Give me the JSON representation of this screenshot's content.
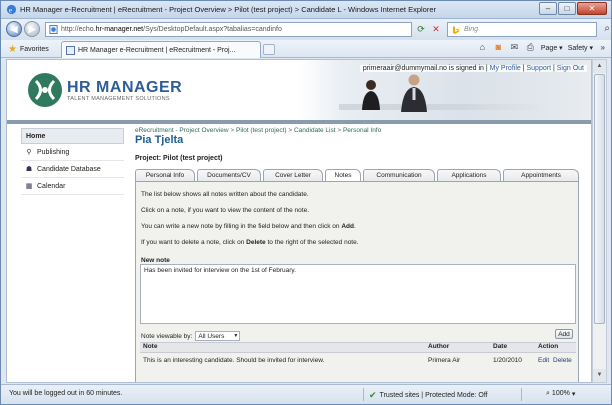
{
  "browser": {
    "title": "HR Manager e-Recruitment | eRecruitment - Project Overview > Pilot (test project) > Candidate L - Windows Internet Explorer",
    "url_prefix": "http://echo.",
    "url_domain": "hr-manager.net",
    "url_path": "/Sys/DesktopDefault.aspx?tabalias=candinfo",
    "search_placeholder": "Bing",
    "favorites_label": "Favorites",
    "tab_title": "HR Manager e-Recruitment | eRecruitment - Proj...",
    "page_menu": "Page ▾",
    "safety_menu": "Safety ▾",
    "status_left": "You will be logged out in 60 minutes.",
    "status_zone": "Trusted sites | Protected Mode: Off",
    "zoom": "100%"
  },
  "header": {
    "logo_name": "HR MANAGER",
    "logo_tagline": "TALENT MANAGEMENT SOLUTIONS",
    "user_email": "primeraair@dummymail.no",
    "signed_in_text": " is signed in | ",
    "my_profile": "My Profile",
    "support": "Support",
    "sign_out": "Sign Out",
    "sep": " | "
  },
  "sidebar": {
    "items": [
      {
        "label": "Home",
        "icon": "home"
      },
      {
        "label": "Publishing",
        "icon": "publishing-icon"
      },
      {
        "label": "Candidate Database",
        "icon": "people-icon"
      },
      {
        "label": "Calendar",
        "icon": "calendar-icon"
      }
    ]
  },
  "main": {
    "breadcrumb": [
      "eRecruitment - Project Overview",
      "Pilot (test project)",
      "Candidate List",
      "Personal Info"
    ],
    "breadcrumb_sep": " > ",
    "candidate_name": "Pia Tjelta",
    "project_label": "Project: Pilot (test project)",
    "tabs": [
      "Personal Info",
      "Documents/CV",
      "Cover Letter",
      "Notes",
      "Communication",
      "Applications",
      "Appointments"
    ],
    "active_tab": "Notes",
    "instructions": {
      "line1": "The list below shows all notes written about the candidate.",
      "line2": "Click on a note, if you want to view the content of the note.",
      "line3_pre": "You can write a new note by filling in the field below and then click on ",
      "line3_bold": "Add",
      "line3_post": ".",
      "line4_pre": "If you want to delete a note, click on ",
      "line4_bold": "Delete",
      "line4_post": " to the right of the selected note."
    },
    "new_note_label": "New note",
    "new_note_value": "Has been invited for interview on the 1st of February.",
    "viewable_label": "Note viewable by:",
    "viewable_value": "All Users",
    "add_button": "Add",
    "table": {
      "headers": [
        "Note",
        "Author",
        "Date",
        "Action"
      ],
      "rows": [
        {
          "note": "This is an interesting candidate. Should be invited for interview.",
          "author": "Primera Air",
          "date": "1/20/2010",
          "edit": "Edit",
          "delete": "Delete"
        }
      ]
    }
  }
}
